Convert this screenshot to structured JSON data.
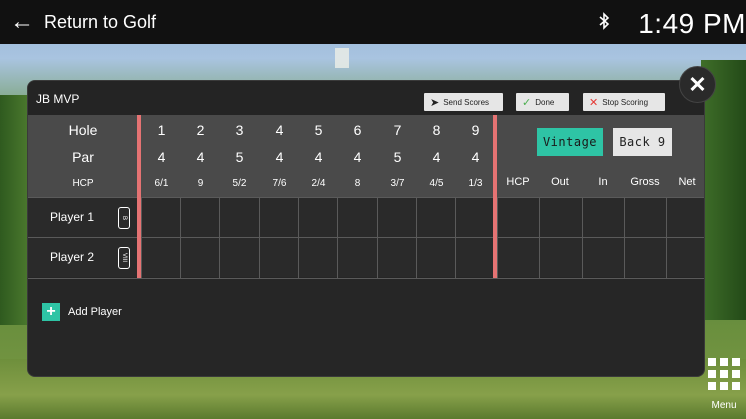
{
  "topbar": {
    "back_label": "Return to Golf",
    "back_icon": "left-arrow-icon",
    "bluetooth_icon": "bluetooth-icon",
    "time": "1:49 PM"
  },
  "modal": {
    "title": "JB MVP",
    "buttons": {
      "send_scores": "Send Scores",
      "done": "Done",
      "stop_scoring": "Stop Scoring"
    },
    "row_labels": {
      "hole": "Hole",
      "par": "Par",
      "hcp": "HCP"
    },
    "holes": [
      "1",
      "2",
      "3",
      "4",
      "5",
      "6",
      "7",
      "8",
      "9"
    ],
    "pars": [
      "4",
      "4",
      "5",
      "4",
      "4",
      "4",
      "5",
      "4",
      "4"
    ],
    "hcps": [
      "6/1",
      "9",
      "5/2",
      "7/6",
      "2/4",
      "8",
      "3/7",
      "4/5",
      "1/3"
    ],
    "summary_labels": [
      "HCP",
      "Out",
      "In",
      "Gross",
      "Net"
    ],
    "vintage_label": "Vintage",
    "back9_label": "Back 9",
    "players": [
      {
        "name": "Player 1",
        "tee": "B"
      },
      {
        "name": "Player 2",
        "tee": "VIII"
      }
    ],
    "add_player_label": "Add Player",
    "accent_color": "#2ec4a5",
    "divider_color": "#e57373"
  },
  "menu": {
    "label": "Menu"
  }
}
